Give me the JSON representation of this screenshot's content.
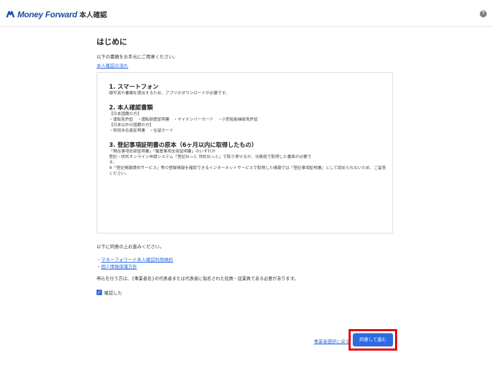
{
  "header": {
    "brand": "Money Forward",
    "title": "本人確認",
    "help_glyph": "?"
  },
  "main": {
    "title": "はじめに",
    "intro": "以下の書類をお手元にご用意ください。",
    "flow_link": "本人確認の流れ"
  },
  "requirements": {
    "section1": {
      "title": "1. スマートフォン",
      "desc": "顔写真や書類を提出するため、アプリのダウンロードが必要です。"
    },
    "section2": {
      "title": "2. 本人確認書類",
      "japan_label": "【日本国籍の方】",
      "japan_docs": "・運転免許証　・運転経歴証明書　・マイナンバーカード　・小型船舶操縦免許証",
      "foreign_label": "【日本以外の国籍の方】",
      "foreign_docs": "・特別永住者証明書　・在留カード"
    },
    "section3": {
      "title": "3. 登記事項証明書の原本（6ヶ月以内に取得したもの）",
      "line1": "「現在事項全部証明書」「履歴事項全部証明書」のいずれか",
      "line2": "登記・供託オンライン申請システム「登記ねっと 供託ねっと」で取り寄せるか、法務局で取得した書面が必要で",
      "line3": "す。",
      "note": "※「登記情報提供サービス」等の登録情報を確認できるインターネットサービスで取得した情報では「登記事項証明書」として認められないため、ご留意ください。"
    }
  },
  "agreement": {
    "text": "以下に同意の上お進みください。",
    "terms": [
      {
        "prefix": "・",
        "label": "マネーフォワード本人確認利用規約"
      },
      {
        "prefix": "・",
        "label": "個人情報保護方針"
      }
    ],
    "notice": "申込を行う方は、{事業者名}の代表者または代表者に指名された役員・従業員である必要があります。",
    "checkbox_label": "確認した",
    "checkbox_checked": true
  },
  "footer": {
    "back_link": "事業者選択に戻る",
    "agree_button": "同意して進む",
    "highlight_color": "#e60000",
    "button_color": "#2d6be1"
  }
}
